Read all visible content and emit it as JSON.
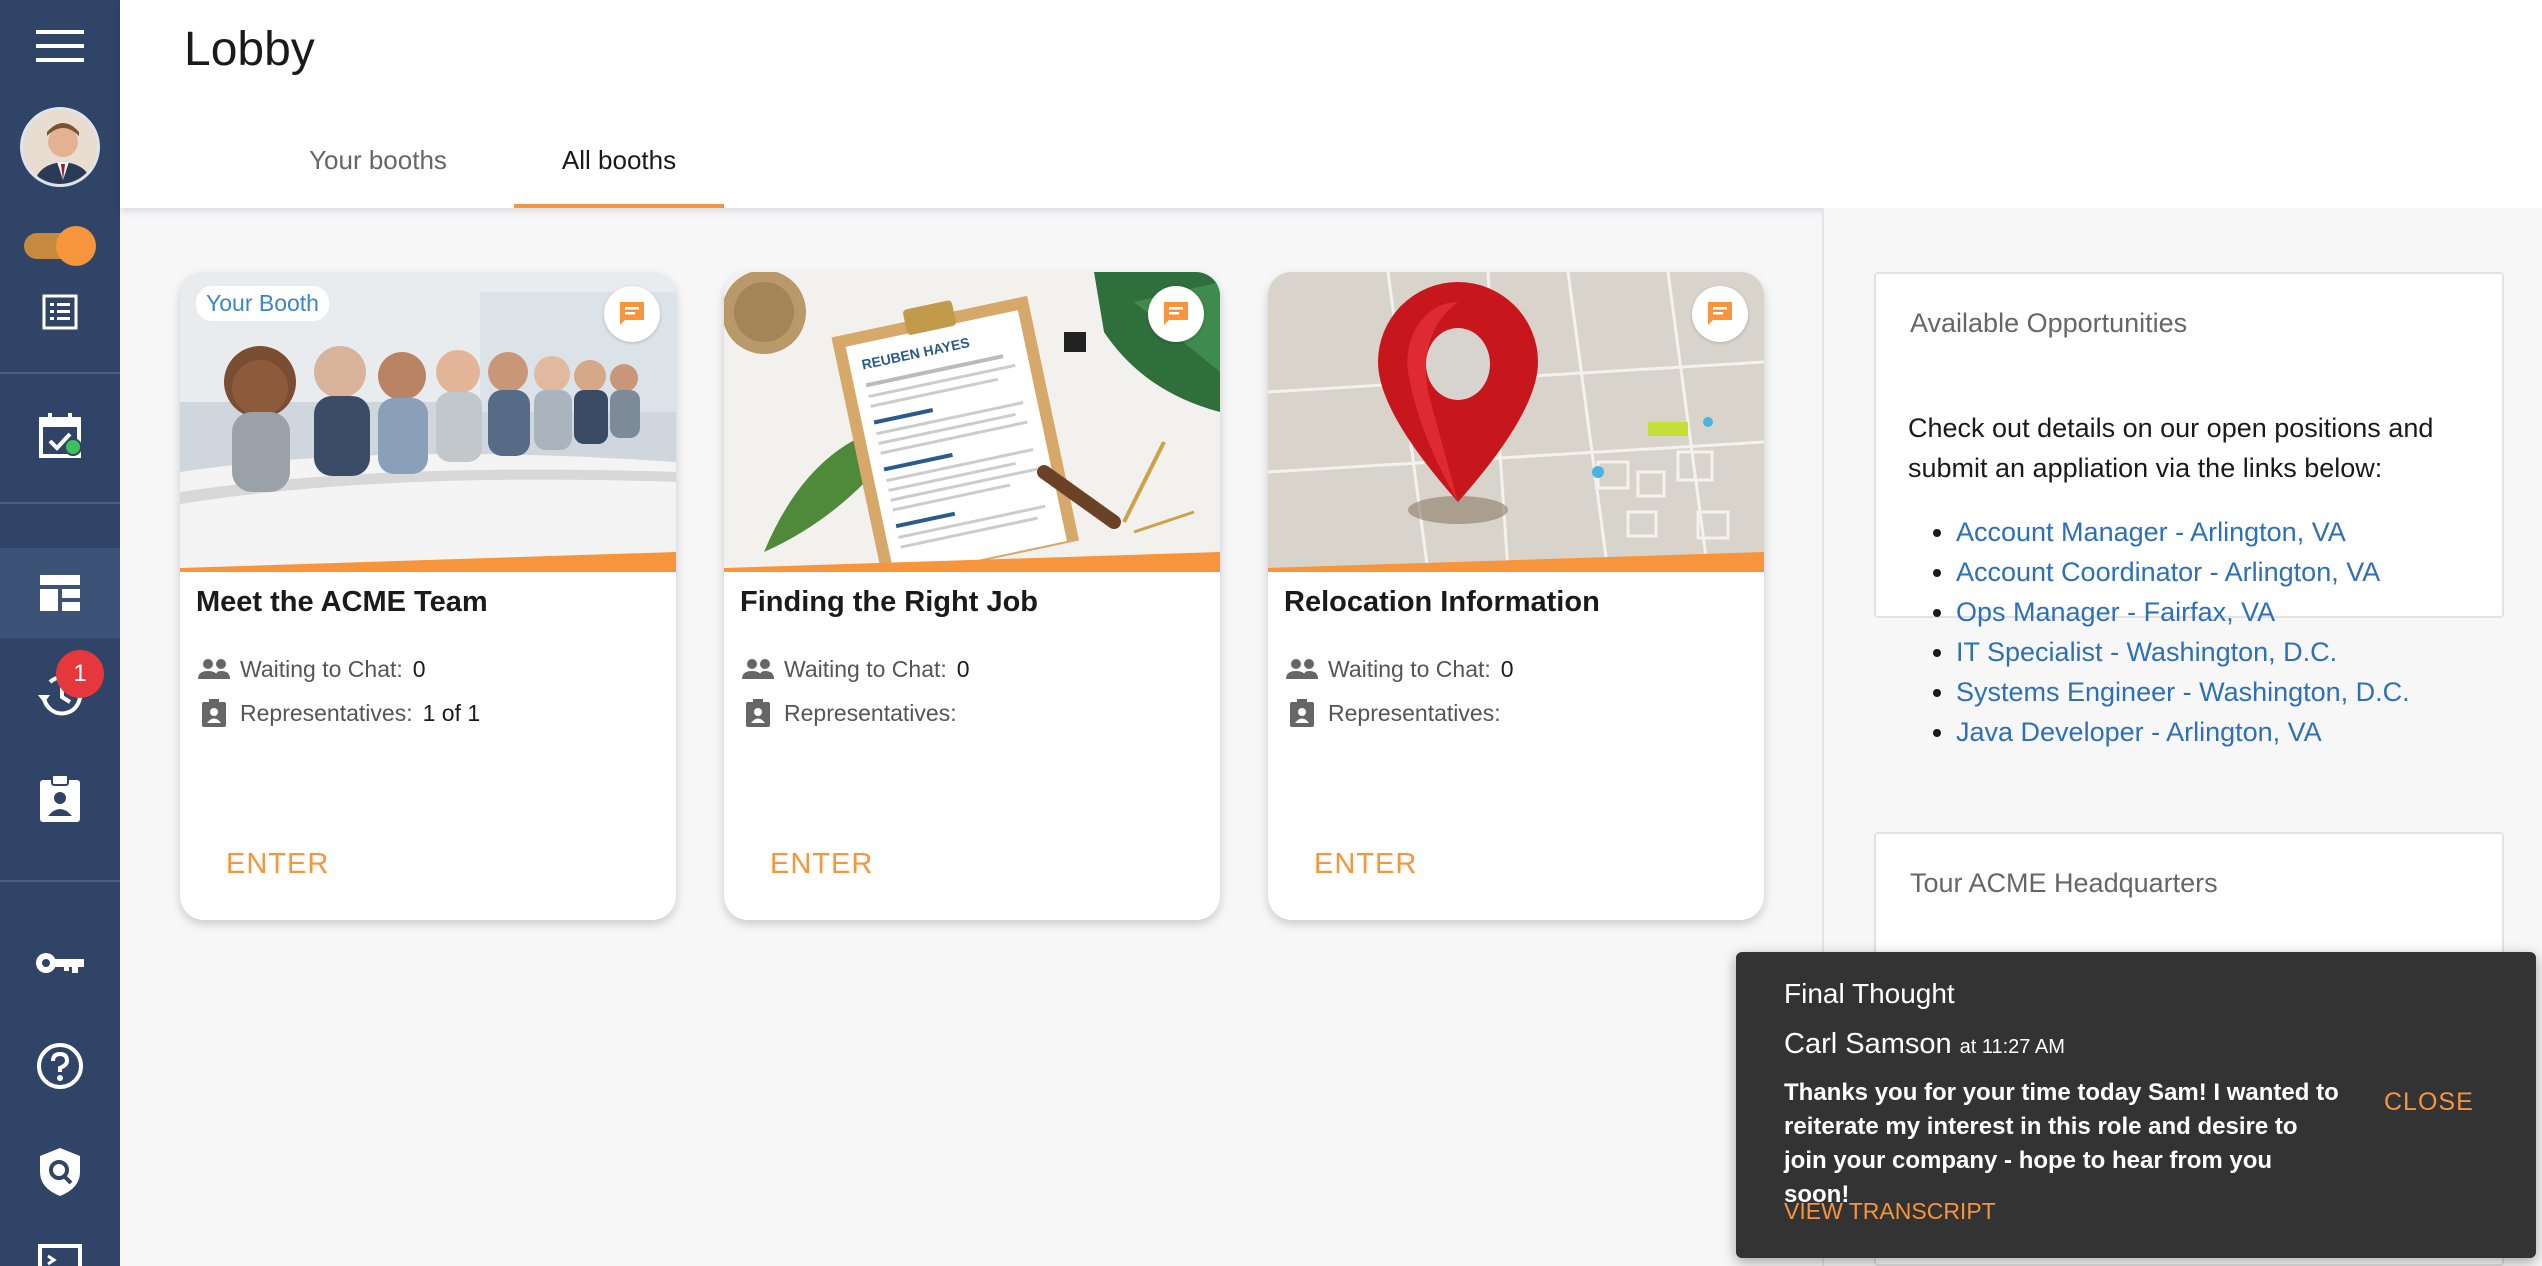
{
  "colors": {
    "sidebar": "#2f4466",
    "accent": "#f6953c",
    "link": "#2d6fb8",
    "toast_bg": "#333333",
    "badge": "#e5373c"
  },
  "sidebar": {
    "items": [
      {
        "icon": "menu-icon"
      },
      {
        "icon": "avatar"
      },
      {
        "icon": "availability-toggle"
      },
      {
        "icon": "list-icon"
      },
      {
        "icon": "calendar-check-icon"
      },
      {
        "icon": "dashboard-icon"
      },
      {
        "icon": "history-icon",
        "badge": "1"
      },
      {
        "icon": "badge-icon"
      },
      {
        "icon": "key-icon"
      },
      {
        "icon": "help-icon"
      },
      {
        "icon": "shield-search-icon"
      },
      {
        "icon": "terminal-icon"
      }
    ]
  },
  "header": {
    "title": "Lobby",
    "tabs": [
      {
        "label": "Your booths",
        "active": false
      },
      {
        "label": "All booths",
        "active": true
      }
    ]
  },
  "booths": [
    {
      "tag": "Your Booth",
      "title": "Meet the ACME Team",
      "waiting_label": "Waiting to Chat:",
      "waiting_value": "0",
      "reps_label": "Representatives:",
      "reps_value": "1 of 1",
      "enter": "ENTER"
    },
    {
      "title": "Finding the Right Job",
      "waiting_label": "Waiting to Chat:",
      "waiting_value": "0",
      "reps_label": "Representatives:",
      "reps_value": "",
      "enter": "ENTER"
    },
    {
      "title": "Relocation Information",
      "waiting_label": "Waiting to Chat:",
      "waiting_value": "0",
      "reps_label": "Representatives:",
      "reps_value": "",
      "enter": "ENTER"
    }
  ],
  "resume_name": "REUBEN HAYES",
  "opportunities": {
    "title": "Available Opportunities",
    "description": "Check out details on our open positions and submit an appliation via the links below:",
    "links": [
      "Account Manager - Arlington, VA",
      "Account Coordinator - Arlington, VA",
      "Ops Manager - Fairfax, VA",
      "IT Specialist - Washington, D.C.",
      "Systems Engineer - Washington, D.C.",
      "Java Developer - Arlington, VA"
    ]
  },
  "tour": {
    "title": "Tour ACME Headquarters"
  },
  "toast": {
    "title": "Final Thought",
    "sender": "Carl Samson",
    "time": "at 11:27 AM",
    "message": "Thanks you for your time today Sam! I wanted to reiterate my interest in this role and desire to join your company - hope to hear from you soon!",
    "close": "CLOSE",
    "view": "VIEW TRANSCRIPT"
  }
}
